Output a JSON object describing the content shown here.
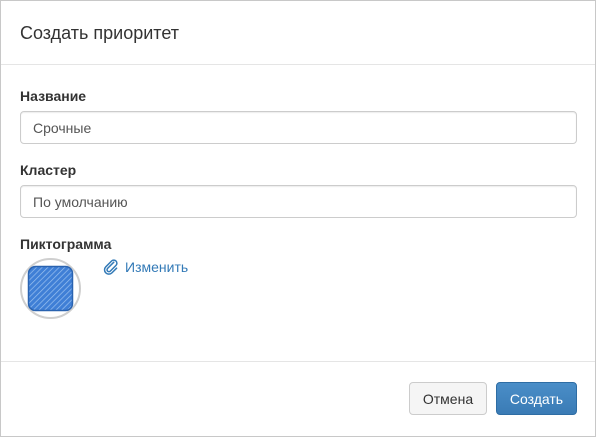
{
  "dialog": {
    "title": "Создать приоритет"
  },
  "form": {
    "name_label": "Название",
    "name_value": "Срочные",
    "cluster_label": "Кластер",
    "cluster_value": "По умолчанию",
    "icon_label": "Пиктограмма",
    "change_link": "Изменить",
    "icon_color": "#3f7fd6"
  },
  "footer": {
    "cancel_label": "Отмена",
    "create_label": "Создать"
  },
  "colors": {
    "link": "#337ab7",
    "primary_button": "#3a7bb5"
  }
}
